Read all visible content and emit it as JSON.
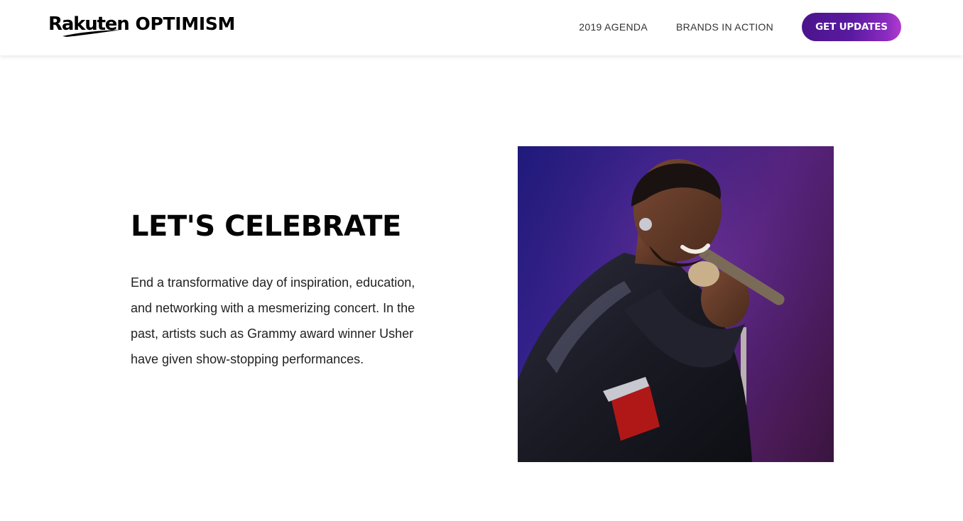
{
  "header": {
    "logo": {
      "mark": "Rakuten",
      "product": "OPTIMISM"
    },
    "nav": [
      {
        "label": "2019 AGENDA"
      },
      {
        "label": "BRANDS IN ACTION"
      }
    ],
    "cta_label": "GET UPDATES"
  },
  "section": {
    "title": "LET'S CELEBRATE",
    "body": "End a transformative day of inspiration, education, and networking with a mesmerizing concert. In the past, artists such as Grammy award winner Usher have given show-stopping performances."
  },
  "colors": {
    "cta_gradient_start": "#4a148c",
    "cta_gradient_end": "#b33bd0",
    "photo_background": "#3a2390"
  }
}
